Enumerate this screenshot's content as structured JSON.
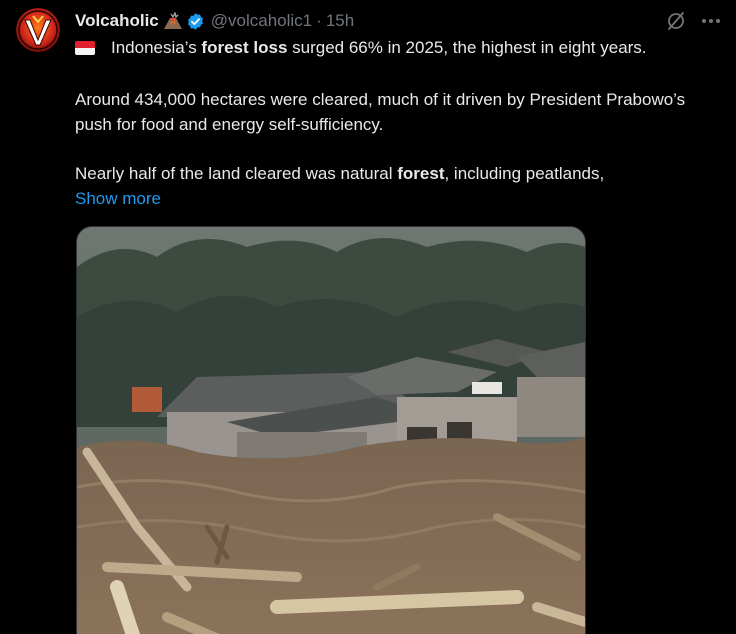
{
  "author": {
    "display_name": "Volcaholic",
    "handle": "@volcaholic1",
    "separator": "·",
    "time": "15h",
    "name_emoji": "volcano-icon",
    "verified_icon": "verified-badge-icon",
    "avatar_icon": "volcaholic-logo-avatar"
  },
  "actions": {
    "grok_icon": "grok-icon",
    "more_icon": "more-options-icon"
  },
  "tweet": {
    "flag_icon": "indonesia-flag-icon",
    "line1_pre": "Indonesia’s ",
    "line1_bold": "forest loss",
    "line1_post": " surged 66% in 2025, the highest in eight years.",
    "para2": "Around 434,000 hectares were cleared, much of it driven by President Prabowo’s push for food and energy self-sufficiency.",
    "para3_pre": "Nearly half of the land cleared was natural ",
    "para3_bold": "forest",
    "para3_post": ", including peatlands,",
    "show_more": "Show more"
  },
  "media": {
    "kind": "video-still",
    "subject": "flood-muddy-water-houses-debris"
  },
  "colors": {
    "background": "#000000",
    "text": "#e7e9ea",
    "secondary": "#71767b",
    "link": "#1d9bf0",
    "verified": "#1d9bf0"
  }
}
